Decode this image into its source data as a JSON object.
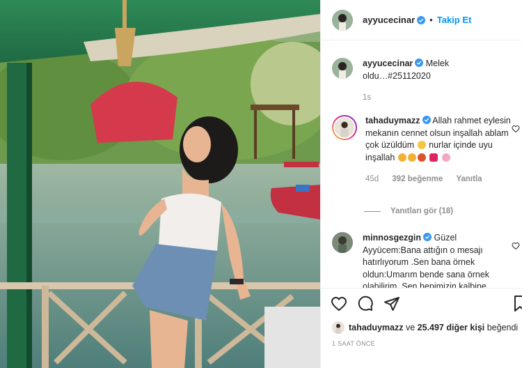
{
  "post": {
    "username": "ayyucecinar",
    "separator": "•",
    "follow_label": "Takip Et",
    "photo_alt": "photo"
  },
  "caption": {
    "username": "ayyucecinar",
    "text": "Melek oldu…#25112020",
    "age": "1s"
  },
  "comments": [
    {
      "username": "tahaduymazz",
      "text": "Allah rahmet eylesin mekanın cennet olsun inşallah ablam çok üzüldüm",
      "text2": "nurlar içinde uyu inşallah",
      "age": "45d",
      "likes": "392 beğenme",
      "reply_label": "Yanıtla",
      "view_replies": "Yanıtları gör (18)"
    },
    {
      "username": "minnosgezgin",
      "text": "Güzel Ayyücem:Bana attığın o mesajı hatırlıyorum .Sen bana örnek oldun:Umarım bende sana örnek olabilirim. Sen hepimizin kalbine"
    }
  ],
  "footer": {
    "liked_user": "tahaduymazz",
    "liked_mid": " ve ",
    "liked_count": "25.497 diğer kişi",
    "liked_tail": " beğendi",
    "timestamp": "1 SAAT ÖNCE"
  },
  "icons": [
    "verified-badge-icon",
    "heart-icon",
    "comment-icon",
    "share-icon",
    "bookmark-icon"
  ],
  "colors": {
    "accent": "#0095f6",
    "muted": "#8e8e8e",
    "text": "#262626"
  }
}
